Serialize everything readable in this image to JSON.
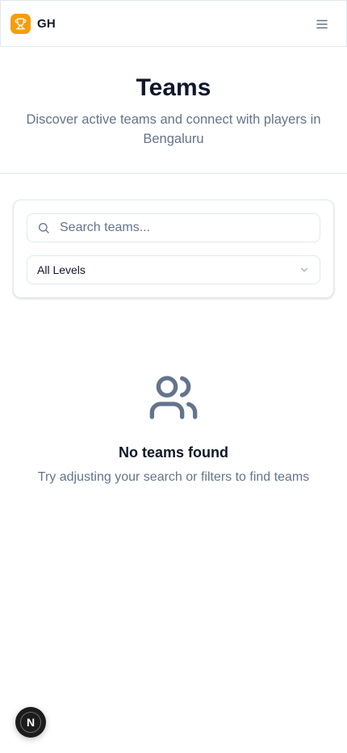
{
  "header": {
    "brand": "GH",
    "logo_icon": "trophy-icon",
    "menu_icon": "hamburger-menu-icon",
    "accent_color": "#f59e0b"
  },
  "hero": {
    "title": "Teams",
    "subtitle": "Discover active teams and connect with players in Bengaluru"
  },
  "filters": {
    "search": {
      "placeholder": "Search teams...",
      "value": "",
      "icon": "search-icon"
    },
    "level_select": {
      "selected": "All Levels",
      "icon": "chevron-down-icon"
    }
  },
  "empty_state": {
    "icon": "users-icon",
    "title": "No teams found",
    "message": "Try adjusting your search or filters to find teams"
  },
  "dev_badge": {
    "letter": "N"
  }
}
